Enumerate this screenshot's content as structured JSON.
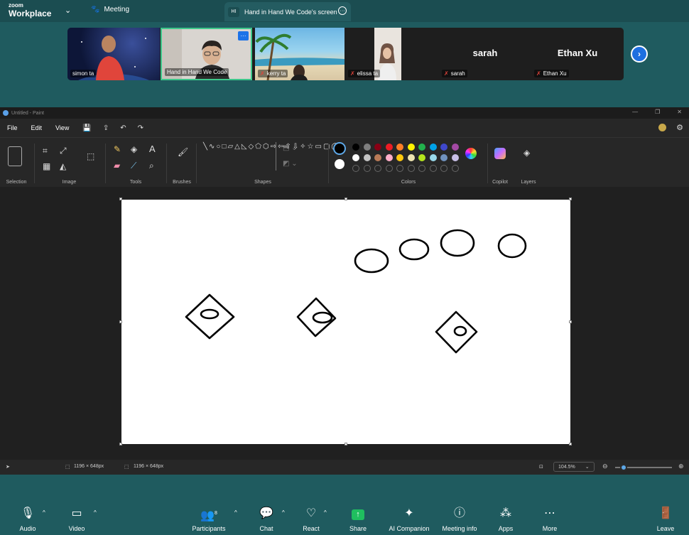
{
  "topbar": {
    "logo_line1": "zoom",
    "logo_line2": "Workplace",
    "meeting_label": "Meeting",
    "share_tab_initials": "HI",
    "share_tab_title": "Hand in Hand We Code's screen"
  },
  "participants": [
    {
      "name": "simon ta",
      "muted": false
    },
    {
      "name": "Hand in Hand We Code",
      "muted": false
    },
    {
      "name": "kerry ta",
      "muted": true
    },
    {
      "name": "elissa ta",
      "muted": true
    },
    {
      "name": "sarah",
      "muted": true,
      "big_name": "sarah"
    },
    {
      "name": "Ethan Xu",
      "muted": true,
      "big_name": "Ethan Xu"
    }
  ],
  "paint": {
    "window_title": "Untitled - Paint",
    "menu": [
      "File",
      "Edit",
      "View"
    ],
    "ribbon_groups": [
      "Selection",
      "Image",
      "Tools",
      "Brushes",
      "Shapes",
      "Colors",
      "Copilot",
      "Layers"
    ],
    "palette_row1": [
      "#000000",
      "#7f7f7f",
      "#880015",
      "#ed1c24",
      "#ff7f27",
      "#fff200",
      "#22b14c",
      "#00a2e8",
      "#3f48cc",
      "#a349a4"
    ],
    "palette_row2": [
      "#ffffff",
      "#c3c3c3",
      "#b97a57",
      "#ffaec9",
      "#ffc90e",
      "#efe4b0",
      "#b5e61d",
      "#99d9ea",
      "#7092be",
      "#c8bfe7"
    ],
    "status": {
      "selection_size": "1196 × 648px",
      "image_size": "1196 × 648px",
      "zoom": "104.5%"
    }
  },
  "toolbar": {
    "audio": "Audio",
    "video": "Video",
    "participants": "Participants",
    "participants_count": "8",
    "chat": "Chat",
    "react": "React",
    "share": "Share",
    "ai_companion": "AI Companion",
    "meeting_info": "Meeting info",
    "apps": "Apps",
    "more": "More",
    "leave": "Leave"
  }
}
